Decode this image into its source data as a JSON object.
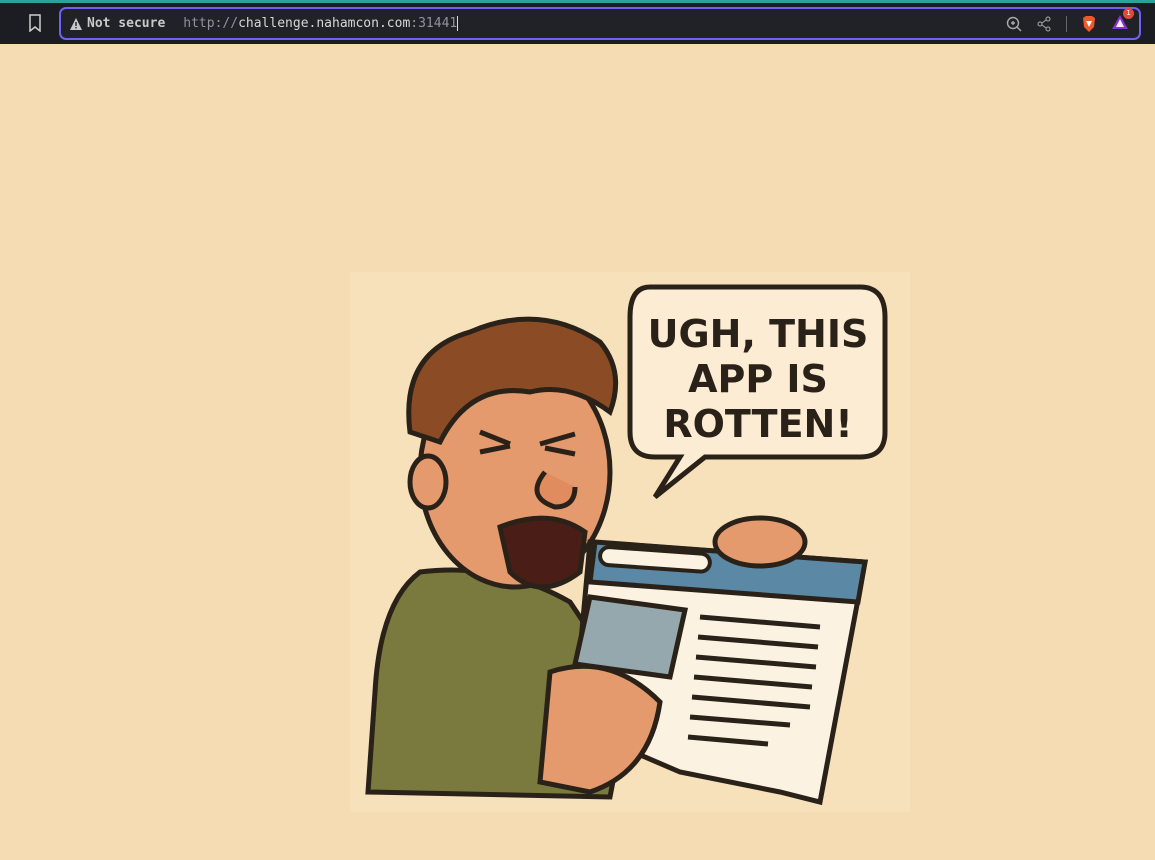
{
  "browser": {
    "security_label": "Not secure",
    "url_scheme": "http://",
    "url_host": "challenge.nahamcon.com",
    "url_port": ":31441",
    "rewards_badge": "1"
  },
  "illustration": {
    "speech_lines": [
      "UGH, THIS",
      "APP IS",
      "ROTTEN!"
    ]
  },
  "colors": {
    "accent": "#6e62f2",
    "page_bg": "#f6dcb2"
  }
}
